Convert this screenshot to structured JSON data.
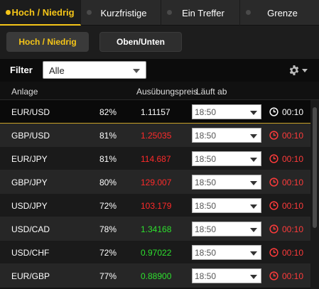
{
  "top_tabs": [
    {
      "label": "Hoch / Niedrig",
      "active": true
    },
    {
      "label": "Kurzfristige",
      "active": false
    },
    {
      "label": "Ein Treffer",
      "active": false
    },
    {
      "label": "Grenze",
      "active": false
    }
  ],
  "sub_tabs": [
    {
      "label": "Hoch / Niedrig",
      "active": true
    },
    {
      "label": "Oben/Unten",
      "active": false
    }
  ],
  "filter": {
    "label": "Filter",
    "value": "Alle"
  },
  "columns": {
    "asset": "Anlage",
    "strike": "Ausübungspreis",
    "expiry": "Läuft ab"
  },
  "rows": [
    {
      "asset": "EUR/USD",
      "payout": "82%",
      "price": "1.11157",
      "price_color": "#ffffff",
      "expiry_select": "18:50",
      "time": "00:10",
      "time_color": "#ffffff"
    },
    {
      "asset": "GBP/USD",
      "payout": "81%",
      "price": "1.25035",
      "price_color": "#ff2a2a",
      "expiry_select": "18:50",
      "time": "00:10",
      "time_color": "#ff3b3b"
    },
    {
      "asset": "EUR/JPY",
      "payout": "81%",
      "price": "114.687",
      "price_color": "#ff2a2a",
      "expiry_select": "18:50",
      "time": "00:10",
      "time_color": "#ff3b3b"
    },
    {
      "asset": "GBP/JPY",
      "payout": "80%",
      "price": "129.007",
      "price_color": "#ff2a2a",
      "expiry_select": "18:50",
      "time": "00:10",
      "time_color": "#ff3b3b"
    },
    {
      "asset": "USD/JPY",
      "payout": "72%",
      "price": "103.179",
      "price_color": "#ff2a2a",
      "expiry_select": "18:50",
      "time": "00:10",
      "time_color": "#ff3b3b"
    },
    {
      "asset": "USD/CAD",
      "payout": "78%",
      "price": "1.34168",
      "price_color": "#2ee02e",
      "expiry_select": "18:50",
      "time": "00:10",
      "time_color": "#ff3b3b"
    },
    {
      "asset": "USD/CHF",
      "payout": "72%",
      "price": "0.97022",
      "price_color": "#2ee02e",
      "expiry_select": "18:50",
      "time": "00:10",
      "time_color": "#ff3b3b"
    },
    {
      "asset": "EUR/GBP",
      "payout": "77%",
      "price": "0.88900",
      "price_color": "#2ee02e",
      "expiry_select": "18:50",
      "time": "00:10",
      "time_color": "#ff3b3b"
    }
  ],
  "icons": {
    "gear": "gear-icon",
    "clock": "clock-icon"
  },
  "colors": {
    "accent": "#f5c518",
    "down": "#ff2a2a",
    "up": "#2ee02e"
  }
}
